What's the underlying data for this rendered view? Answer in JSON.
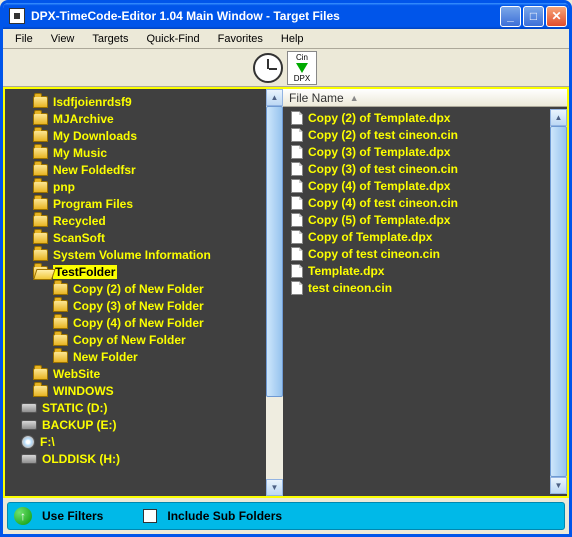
{
  "window": {
    "title": "DPX-TimeCode-Editor 1.04 Main Window - Target Files"
  },
  "menu": [
    "File",
    "View",
    "Targets",
    "Quick-Find",
    "Favorites",
    "Help"
  ],
  "toolbar": {
    "cin": "Cin",
    "dpx": "DPX"
  },
  "tree": {
    "folders": [
      "Isdfjoienrdsf9",
      "MJArchive",
      "My Downloads",
      "My Music",
      "New Foldedfsr",
      "pnp",
      "Program Files",
      "Recycled",
      "ScanSoft",
      "System Volume Information"
    ],
    "selected": "TestFolder",
    "subfolders": [
      "Copy (2) of New Folder",
      "Copy (3) of New Folder",
      "Copy (4) of New Folder",
      "Copy of New Folder",
      "New Folder"
    ],
    "folders_after": [
      "WebSite",
      "WINDOWS"
    ],
    "drives": [
      {
        "label": "STATIC (D:)",
        "type": "hd"
      },
      {
        "label": "BACKUP (E:)",
        "type": "hd"
      },
      {
        "label": "F:\\",
        "type": "cd"
      },
      {
        "label": "OLDDISK (H:)",
        "type": "hd"
      }
    ]
  },
  "filelist": {
    "header": "File Name",
    "files": [
      "Copy (2) of Template.dpx",
      "Copy (2) of test cineon.cin",
      "Copy (3) of Template.dpx",
      "Copy (3) of test cineon.cin",
      "Copy (4) of Template.dpx",
      "Copy (4) of test cineon.cin",
      "Copy (5) of Template.dpx",
      "Copy of Template.dpx",
      "Copy of test cineon.cin",
      "Template.dpx",
      "test cineon.cin"
    ]
  },
  "status": {
    "use_filters": "Use Filters",
    "include_sub": "Include Sub Folders"
  }
}
